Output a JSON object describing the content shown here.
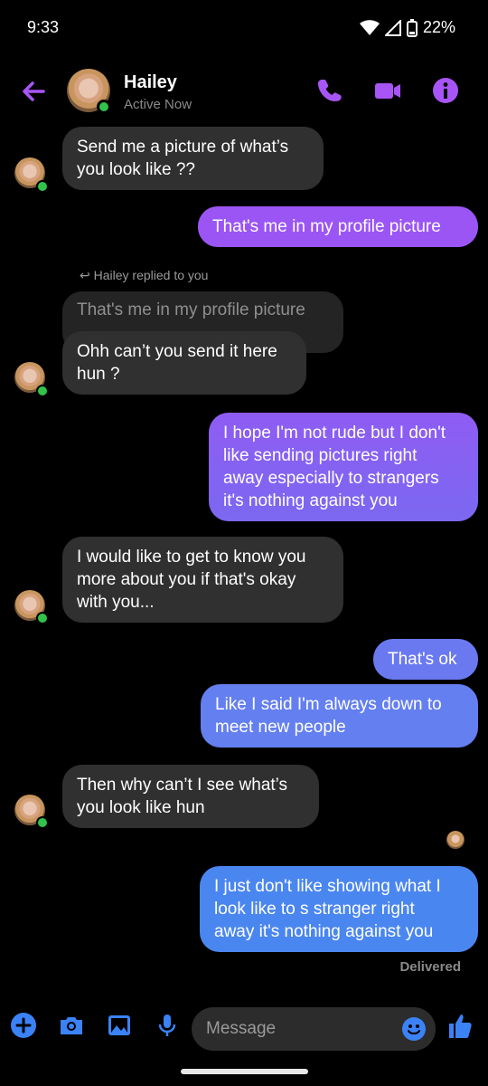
{
  "status_bar": {
    "time": "9:33",
    "battery": "22%"
  },
  "header": {
    "name": "Hailey",
    "status": "Active Now"
  },
  "messages": {
    "m1": "Send me a picture of what’s\nyou look like ??",
    "m2": "That's me in my profile picture",
    "reply_label": "Hailey replied to you",
    "reply_quote": "That's me in my profile picture",
    "m3": "Ohh can’t you send it here\nhun ?",
    "m4": "I hope I'm not rude but I don't\nlike sending pictures right\naway especially to strangers\nit's nothing against you",
    "m5": "I would like to get to know you\nmore about you if that's okay\nwith you...",
    "m6": "That's ok",
    "m7": "Like I said I'm always down to\nmeet new people",
    "m8": "Then why can’t I see what’s\nyou look like hun",
    "m9": "I just don't like showing what I\nlook like to s stranger right\naway it's nothing against you",
    "delivered": "Delivered"
  },
  "composer": {
    "placeholder": "Message"
  },
  "colors": {
    "accent": "#a855f7",
    "out_purple": "#9b55f5",
    "out_blue": "#4a86f0",
    "in_bubble": "#303030"
  }
}
